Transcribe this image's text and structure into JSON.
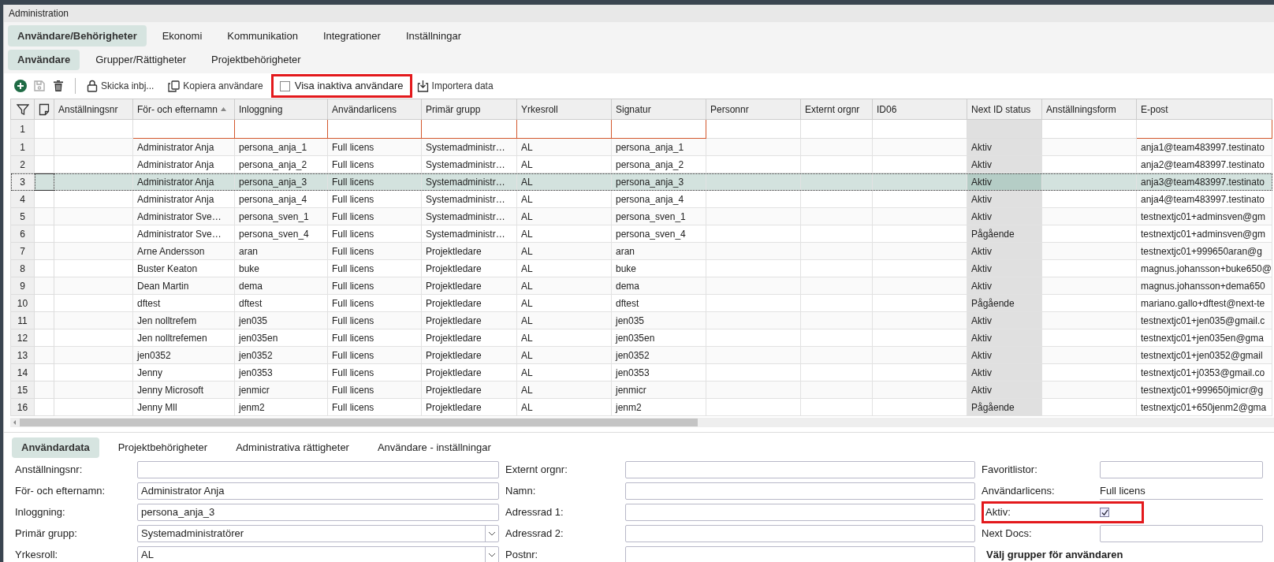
{
  "window": {
    "title": "Administration"
  },
  "main_tabs": [
    {
      "label": "Användare/Behörigheter",
      "selected": true
    },
    {
      "label": "Ekonomi",
      "selected": false
    },
    {
      "label": "Kommunikation",
      "selected": false
    },
    {
      "label": "Integrationer",
      "selected": false
    },
    {
      "label": "Inställningar",
      "selected": false
    }
  ],
  "sub_tabs": [
    {
      "label": "Användare",
      "selected": true
    },
    {
      "label": "Grupper/Rättigheter",
      "selected": false
    },
    {
      "label": "Projektbehörigheter",
      "selected": false
    }
  ],
  "toolbar": [
    {
      "kind": "add",
      "disabled": false
    },
    {
      "kind": "save",
      "disabled": true
    },
    {
      "kind": "delete",
      "disabled": false
    },
    {
      "kind": "separator"
    },
    {
      "kind": "invite",
      "label": "Skicka inbj..."
    },
    {
      "kind": "copy",
      "label": "Kopiera användare"
    },
    {
      "kind": "checkbox",
      "label": "Visa inaktiva användare",
      "checked": false,
      "highlighted": true
    },
    {
      "kind": "import",
      "label": "Importera data"
    }
  ],
  "table": {
    "columns": [
      {
        "label": "Anställningsnr",
        "kind": "text",
        "filter": false
      },
      {
        "label": "För- och efternamn",
        "kind": "text",
        "filter": true,
        "sorted": true
      },
      {
        "label": "Inloggning",
        "kind": "text",
        "filter": true
      },
      {
        "label": "Användarlicens",
        "kind": "text",
        "filter": true
      },
      {
        "label": "Primär grupp",
        "kind": "text",
        "filter": true
      },
      {
        "label": "Yrkesroll",
        "kind": "text",
        "filter": true
      },
      {
        "label": "Signatur",
        "kind": "text",
        "filter": true
      },
      {
        "label": "Personnr",
        "kind": "text",
        "filter": false
      },
      {
        "label": "Externt orgnr",
        "kind": "text",
        "filter": false
      },
      {
        "label": "ID06",
        "kind": "text",
        "filter": false
      },
      {
        "label": "Next ID status",
        "kind": "status",
        "filter": false
      },
      {
        "label": "Anställningsform",
        "kind": "text",
        "filter": false
      },
      {
        "label": "E-post",
        "kind": "text",
        "filter": true
      }
    ],
    "filter_row": {
      "number": "1"
    },
    "rows": [
      {
        "number": "1",
        "selected": false,
        "cells": [
          null,
          "Administrator Anja",
          "persona_anja_1",
          "Full licens",
          "Systemadministr…",
          "AL",
          "persona_anja_1",
          null,
          null,
          null,
          "Aktiv",
          null,
          "anja1@team483997.testinato"
        ]
      },
      {
        "number": "2",
        "selected": false,
        "cells": [
          null,
          "Administrator Anja",
          "persona_anja_2",
          "Full licens",
          "Systemadministr…",
          "AL",
          "persona_anja_2",
          null,
          null,
          null,
          "Aktiv",
          null,
          "anja2@team483997.testinato"
        ]
      },
      {
        "number": "3",
        "selected": true,
        "cells": [
          null,
          "Administrator Anja",
          "persona_anja_3",
          "Full licens",
          "Systemadministr…",
          "AL",
          "persona_anja_3",
          null,
          null,
          null,
          "Aktiv",
          null,
          "anja3@team483997.testinato"
        ]
      },
      {
        "number": "4",
        "selected": false,
        "cells": [
          null,
          "Administrator Anja",
          "persona_anja_4",
          "Full licens",
          "Systemadministr…",
          "AL",
          "persona_anja_4",
          null,
          null,
          null,
          "Aktiv",
          null,
          "anja4@team483997.testinato"
        ]
      },
      {
        "number": "5",
        "selected": false,
        "cells": [
          null,
          "Administrator Sve…",
          "persona_sven_1",
          "Full licens",
          "Systemadministr…",
          "AL",
          "persona_sven_1",
          null,
          null,
          null,
          "Aktiv",
          null,
          "testnextjc01+adminsven@gm"
        ]
      },
      {
        "number": "6",
        "selected": false,
        "cells": [
          null,
          "Administrator Sve…",
          "persona_sven_4",
          "Full licens",
          "Systemadministr…",
          "AL",
          "persona_sven_4",
          null,
          null,
          null,
          "Pågående",
          null,
          "testnextjc01+adminsven@gm"
        ]
      },
      {
        "number": "7",
        "selected": false,
        "cells": [
          null,
          "Arne Andersson",
          "aran",
          "Full licens",
          "Projektledare",
          "AL",
          "aran",
          null,
          null,
          null,
          "Aktiv",
          null,
          "testnextjc01+999650aran@g"
        ]
      },
      {
        "number": "8",
        "selected": false,
        "cells": [
          null,
          "Buster Keaton",
          "buke",
          "Full licens",
          "Projektledare",
          "AL",
          "buke",
          null,
          null,
          null,
          "Aktiv",
          null,
          "magnus.johansson+buke650@"
        ]
      },
      {
        "number": "9",
        "selected": false,
        "cells": [
          null,
          "Dean Martin",
          "dema",
          "Full licens",
          "Projektledare",
          "AL",
          "dema",
          null,
          null,
          null,
          "Aktiv",
          null,
          "magnus.johansson+dema650"
        ]
      },
      {
        "number": "10",
        "selected": false,
        "cells": [
          null,
          "dftest",
          "dftest",
          "Full licens",
          "Projektledare",
          "AL",
          "dftest",
          null,
          null,
          null,
          "Pågående",
          null,
          "mariano.gallo+dftest@next-te"
        ]
      },
      {
        "number": "11",
        "selected": false,
        "cells": [
          null,
          "Jen nolltrefem",
          "jen035",
          "Full licens",
          "Projektledare",
          "AL",
          "jen035",
          null,
          null,
          null,
          "Aktiv",
          null,
          "testnextjc01+jen035@gmail.c"
        ]
      },
      {
        "number": "12",
        "selected": false,
        "cells": [
          null,
          "Jen nolltrefemen",
          "jen035en",
          "Full licens",
          "Projektledare",
          "AL",
          "jen035en",
          null,
          null,
          null,
          "Aktiv",
          null,
          "testnextjc01+jen035en@gma"
        ]
      },
      {
        "number": "13",
        "selected": false,
        "cells": [
          null,
          "jen0352",
          "jen0352",
          "Full licens",
          "Projektledare",
          "AL",
          "jen0352",
          null,
          null,
          null,
          "Aktiv",
          null,
          "testnextjc01+jen0352@gmail"
        ]
      },
      {
        "number": "14",
        "selected": false,
        "cells": [
          null,
          "Jenny",
          "jen0353",
          "Full licens",
          "Projektledare",
          "AL",
          "jen0353",
          null,
          null,
          null,
          "Aktiv",
          null,
          "testnextjc01+j0353@gmail.co"
        ]
      },
      {
        "number": "15",
        "selected": false,
        "cells": [
          null,
          "Jenny Microsoft",
          "jenmicr",
          "Full licens",
          "Projektledare",
          "AL",
          "jenmicr",
          null,
          null,
          null,
          "Aktiv",
          null,
          "testnextjc01+999650jmicr@g"
        ]
      },
      {
        "number": "16",
        "selected": false,
        "cells": [
          null,
          "Jenny Mll",
          "jenm2",
          "Full licens",
          "Projektledare",
          "AL",
          "jenm2",
          null,
          null,
          null,
          "Pågående",
          null,
          "testnextjc01+650jenm2@gma"
        ]
      }
    ]
  },
  "detail_tabs": [
    {
      "label": "Användardata",
      "selected": true
    },
    {
      "label": "Projektbehörigheter",
      "selected": false
    },
    {
      "label": "Administrativa rättigheter",
      "selected": false
    },
    {
      "label": "Användare - inställningar",
      "selected": false
    }
  ],
  "form": {
    "left": [
      {
        "label": "Anställningsnr:",
        "kind": "text"
      },
      {
        "label": "För- och efternamn:",
        "kind": "text",
        "value": "Administrator Anja"
      },
      {
        "label": "Inloggning:",
        "kind": "text",
        "value": "persona_anja_3"
      },
      {
        "label": "Primär grupp:",
        "kind": "select",
        "value": "Systemadministratörer"
      },
      {
        "label": "Yrkesroll:",
        "kind": "select",
        "value": "AL"
      }
    ],
    "middle": [
      {
        "label": "Externt orgnr:",
        "kind": "text"
      },
      {
        "label": "Namn:",
        "kind": "text"
      },
      {
        "label": "Adressrad 1:",
        "kind": "text"
      },
      {
        "label": "Adressrad 2:",
        "kind": "text"
      },
      {
        "label": "Postnr:",
        "kind": "text"
      }
    ],
    "right": [
      {
        "label": "Favoritlistor:",
        "kind": "text"
      },
      {
        "label": "Användarlicens:",
        "kind": "static",
        "value": "Full licens"
      },
      {
        "label": "Aktiv:",
        "kind": "checkbox",
        "checked": true,
        "highlighted": true
      },
      {
        "label": "Next Docs:",
        "kind": "text"
      },
      {
        "label": "Välj grupper för användaren",
        "kind": "heading"
      }
    ]
  }
}
